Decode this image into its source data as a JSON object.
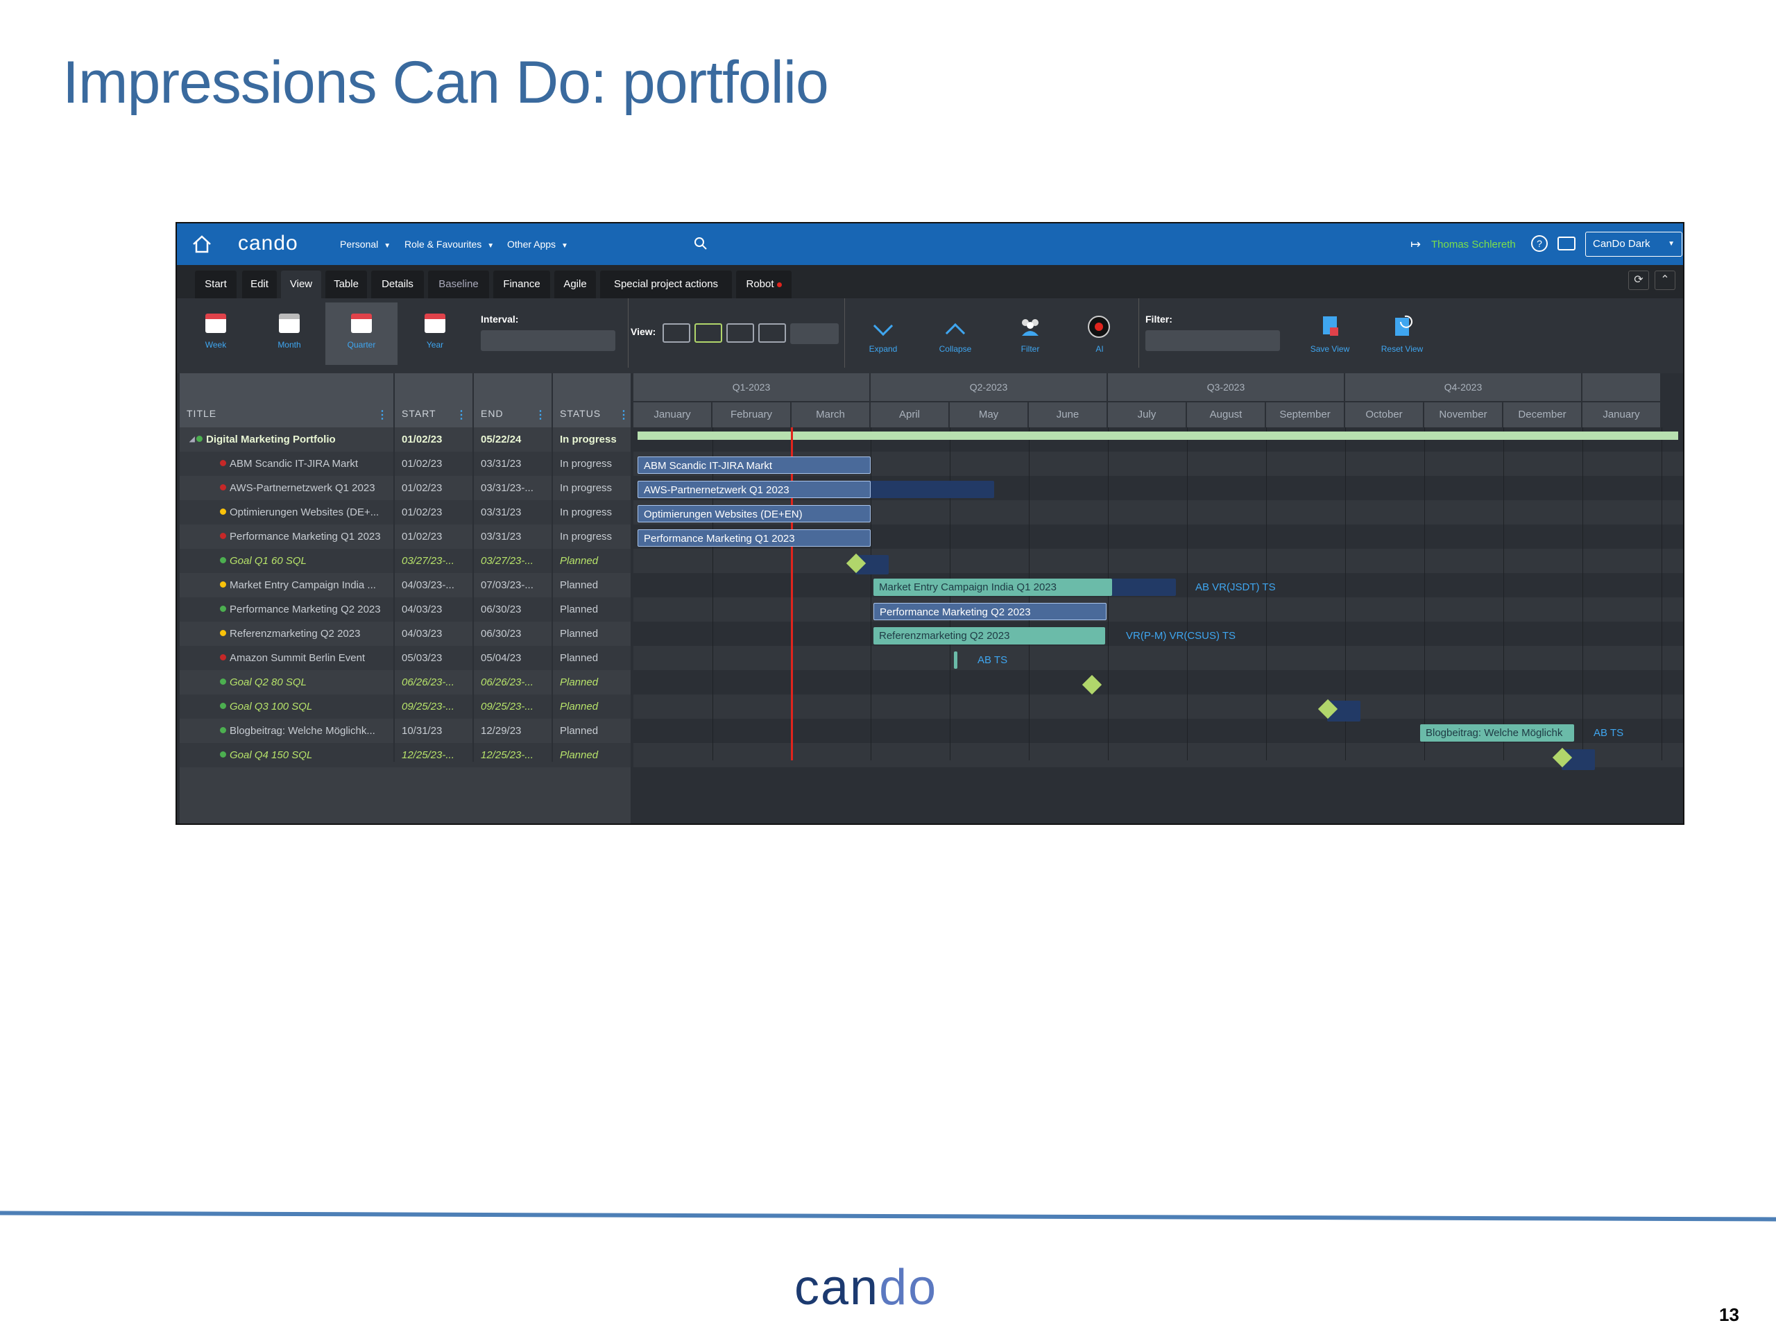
{
  "slide": {
    "title": "Impressions Can Do: portfolio",
    "page_number": "13",
    "footer_logo_a": "can",
    "footer_logo_b": "do"
  },
  "topbar": {
    "logo": "cando",
    "menus": [
      "Personal",
      "Role & Favourites",
      "Other Apps"
    ],
    "user": "Thomas Schlereth",
    "theme": "CanDo Dark",
    "help": "?"
  },
  "tabs": [
    "Start",
    "Edit",
    "View",
    "Table",
    "Details",
    "Baseline",
    "Finance",
    "Agile",
    "Special project actions",
    "Robot"
  ],
  "ribbon": {
    "buttons": [
      "Week",
      "Month",
      "Quarter",
      "Year"
    ],
    "interval_label": "Interval:",
    "view_label": "View:",
    "actions": [
      "Expand",
      "Collapse",
      "Filter",
      "AI"
    ],
    "filter_label": "Filter:",
    "save_view": "Save View",
    "reset_view": "Reset View"
  },
  "table": {
    "headers": [
      "TITLE",
      "START",
      "END",
      "STATUS"
    ],
    "rows": [
      {
        "title": "Digital Marketing Portfolio",
        "start": "01/02/23",
        "end": "05/22/24",
        "status": "In progress",
        "dot": "#4caf50"
      },
      {
        "title": "ABM Scandic IT-JIRA Markt",
        "start": "01/02/23",
        "end": "03/31/23",
        "status": "In progress",
        "dot": "#c62828"
      },
      {
        "title": "AWS-Partnernetzwerk Q1 2023",
        "start": "01/02/23",
        "end": "03/31/23-...",
        "status": "In progress",
        "dot": "#c62828"
      },
      {
        "title": "Optimierungen Websites (DE+...",
        "start": "01/02/23",
        "end": "03/31/23",
        "status": "In progress",
        "dot": "#f9c20a"
      },
      {
        "title": "Performance Marketing Q1 2023",
        "start": "01/02/23",
        "end": "03/31/23",
        "status": "In progress",
        "dot": "#c62828"
      },
      {
        "title": "Goal Q1 60 SQL",
        "start": "03/27/23-...",
        "end": "03/27/23-...",
        "status": "Planned",
        "dot": "#4caf50"
      },
      {
        "title": "Market Entry Campaign India ...",
        "start": "04/03/23-...",
        "end": "07/03/23-...",
        "status": "Planned",
        "dot": "#f9c20a"
      },
      {
        "title": "Performance Marketing Q2 2023",
        "start": "04/03/23",
        "end": "06/30/23",
        "status": "Planned",
        "dot": "#4caf50"
      },
      {
        "title": "Referenzmarketing Q2 2023",
        "start": "04/03/23",
        "end": "06/30/23",
        "status": "Planned",
        "dot": "#f9c20a"
      },
      {
        "title": "Amazon Summit Berlin Event",
        "start": "05/03/23",
        "end": "05/04/23",
        "status": "Planned",
        "dot": "#c62828"
      },
      {
        "title": "Goal Q2 80 SQL",
        "start": "06/26/23-...",
        "end": "06/26/23-...",
        "status": "Planned",
        "dot": "#4caf50"
      },
      {
        "title": "Goal Q3 100 SQL",
        "start": "09/25/23-...",
        "end": "09/25/23-...",
        "status": "Planned",
        "dot": "#4caf50"
      },
      {
        "title": "Blogbeitrag: Welche Möglichk...",
        "start": "10/31/23",
        "end": "12/29/23",
        "status": "Planned",
        "dot": "#4caf50"
      },
      {
        "title": "Goal Q4 150 SQL",
        "start": "12/25/23-...",
        "end": "12/25/23-...",
        "status": "Planned",
        "dot": "#4caf50"
      }
    ]
  },
  "gantt": {
    "quarters": [
      "Q1-2023",
      "Q2-2023",
      "Q3-2023",
      "Q4-2023"
    ],
    "months": [
      "January",
      "February",
      "March",
      "April",
      "May",
      "June",
      "July",
      "August",
      "September",
      "October",
      "November",
      "December",
      "January"
    ],
    "bars": [
      "ABM Scandic IT-JIRA Markt",
      "AWS-Partnernetzwerk Q1 2023",
      "Optimierungen Websites (DE+EN)",
      "Performance Marketing Q1 2023",
      "Market Entry Campaign India Q1 2023",
      "Performance Marketing Q2 2023",
      "Referenzmarketing Q2 2023",
      "Blogbeitrag: Welche Möglichk"
    ],
    "resources": {
      "india": "AB  VR(JSDT)  TS",
      "referenz": "VR(P-M)  VR(CSUS)  TS",
      "amazon": "AB  TS",
      "blog": "AB  TS"
    }
  }
}
